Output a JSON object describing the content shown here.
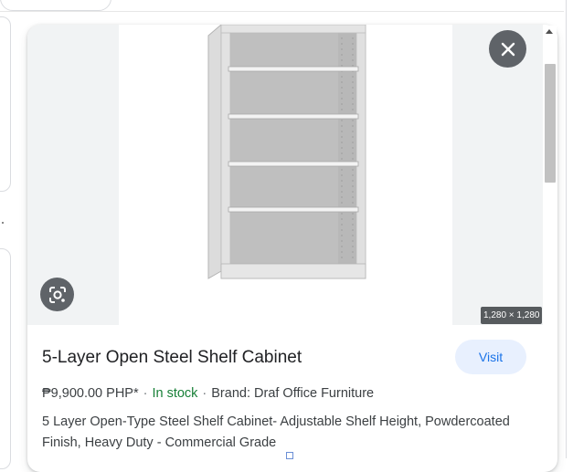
{
  "image": {
    "dimensions": "1,280 × 1,280",
    "alt": "5-Layer Open Steel Shelf Cabinet"
  },
  "icons": {
    "close": "close-icon",
    "lens": "lens-icon"
  },
  "product": {
    "title": "5-Layer Open Steel Shelf Cabinet",
    "visit_label": "Visit",
    "price": "₱9,900.00 PHP*",
    "separator": "·",
    "stock": "In stock",
    "brand": "Brand: Draf Office Furniture",
    "description": "5 Layer Open-Type Steel Shelf Cabinet- Adjustable Shelf Height, Powdercoated Finish, Heavy Duty - Commercial Grade"
  },
  "colors": {
    "stock_green": "#188038",
    "visit_text": "#1a73e8",
    "visit_bg": "#e8f0fe",
    "overlay_button": "#5f6368"
  }
}
